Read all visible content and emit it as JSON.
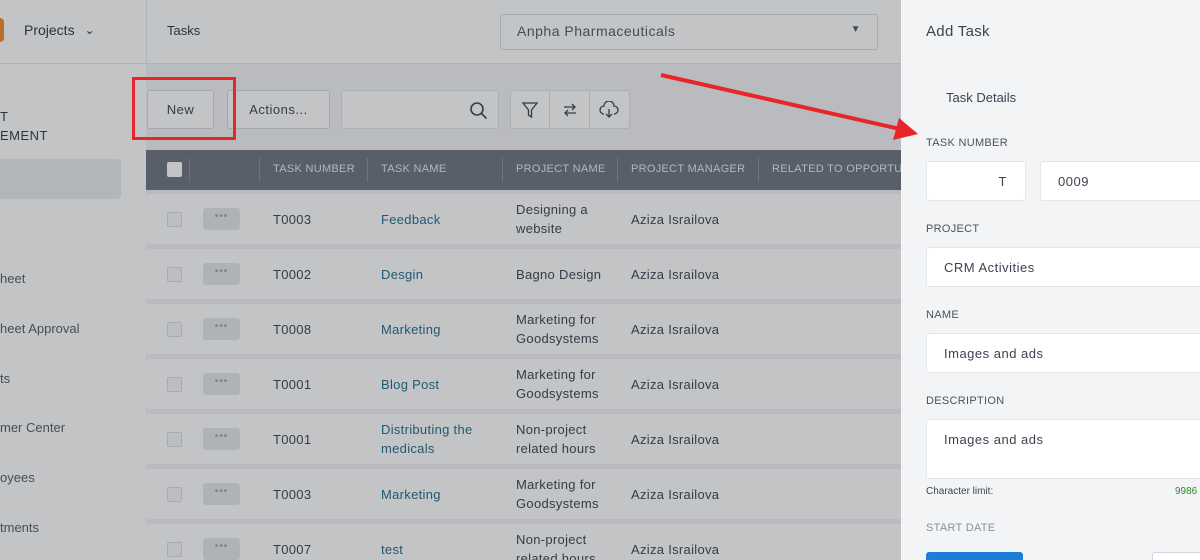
{
  "header": {
    "projects_menu_label": "Projects",
    "breadcrumb": "Tasks",
    "company_selected": "Anpha Pharmaceuticals"
  },
  "sidebar": {
    "section_title_line1": "T",
    "section_title_line2": "EMENT",
    "items": [
      {
        "label": "heet"
      },
      {
        "label": "heet Approval"
      },
      {
        "label": "ts"
      },
      {
        "label": "mer Center"
      },
      {
        "label": "oyees"
      },
      {
        "label": "tments"
      }
    ]
  },
  "toolbar": {
    "new_label": "New",
    "actions_label": "Actions...",
    "search_value": ""
  },
  "table": {
    "columns": [
      "TASK NUMBER",
      "TASK NAME",
      "PROJECT NAME",
      "PROJECT MANAGER",
      "RELATED TO OPPORTUNITY"
    ],
    "rows": [
      {
        "task_number": "T0003",
        "task_name": "Feedback",
        "project_name": "Designing a website",
        "project_manager": "Aziza Israilova"
      },
      {
        "task_number": "T0002",
        "task_name": "Desgin",
        "project_name": "Bagno Design",
        "project_manager": "Aziza Israilova"
      },
      {
        "task_number": "T0008",
        "task_name": "Marketing",
        "project_name": "Marketing for Goodsystems",
        "project_manager": "Aziza Israilova"
      },
      {
        "task_number": "T0001",
        "task_name": "Blog Post",
        "project_name": "Marketing for Goodsystems",
        "project_manager": "Aziza Israilova"
      },
      {
        "task_number": "T0001",
        "task_name": "Distributing the medicals",
        "project_name": "Non-project related hours",
        "project_manager": "Aziza Israilova"
      },
      {
        "task_number": "T0003",
        "task_name": "Marketing",
        "project_name": "Marketing for Goodsystems",
        "project_manager": "Aziza Israilova"
      },
      {
        "task_number": "T0007",
        "task_name": "test",
        "project_name": "Non-project related hours",
        "project_manager": "Aziza Israilova"
      }
    ],
    "row_menu_glyph": "•••"
  },
  "panel": {
    "title": "Add Task",
    "tab": "Task Details",
    "task_number_label": "TASK NUMBER",
    "task_number_prefix": "T",
    "task_number_value": "0009",
    "project_label": "PROJECT",
    "project_value": "CRM Activities",
    "name_label": "NAME",
    "name_value": "Images and ads",
    "description_label": "DESCRIPTION",
    "description_value": "Images and ads",
    "char_limit_label": "Character limit:",
    "char_limit_value": "9986",
    "start_date_label": "START DATE"
  },
  "colors": {
    "highlight_red": "#e8262a",
    "link_teal": "#1f6b8c",
    "header_gray": "#6b7380",
    "primary_blue": "#1c7ed6"
  }
}
